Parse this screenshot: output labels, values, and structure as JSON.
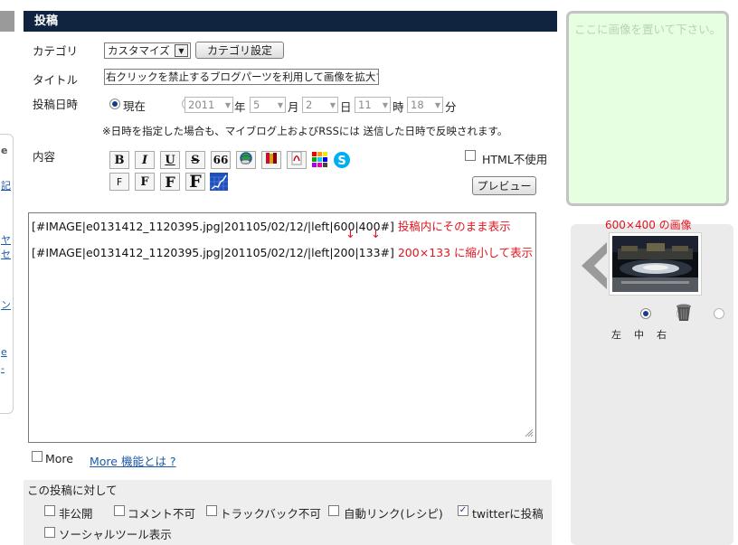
{
  "header": {
    "title": "投稿"
  },
  "left_sidebar": {
    "fragments": [
      "e",
      "記",
      "ヤ",
      "セ",
      "ン",
      "e",
      "-"
    ]
  },
  "form": {
    "category_label": "カテゴリ",
    "category_value": "カスタマイズ",
    "category_button": "カテゴリ設定",
    "title_label": "タイトル",
    "title_value": "右クリックを禁止するブログパーツを利用して画像を拡大する",
    "datetime_label": "投稿日時",
    "now_label": "現在",
    "year_value": "2011",
    "year_suffix": "年",
    "month_value": "5",
    "month_suffix": "月",
    "day_value": "2",
    "day_suffix": "日",
    "hour_value": "11",
    "hour_suffix": "時",
    "minute_value": "18",
    "minute_suffix": "分",
    "note": "※日時を指定した場合も、マイブログ上およびRSSには 送信した日時で反映されます。",
    "content_label": "内容",
    "html_disable_label": "HTML不使用",
    "preview_button": "プレビュー"
  },
  "toolbar": {
    "bold": "B",
    "italic": "I",
    "underline": "U",
    "strike": "S",
    "quote": "66",
    "font_sizes": [
      "F",
      "F",
      "F",
      "F"
    ]
  },
  "editor": {
    "line1": "[#IMAGE|e0131412_1120395.jpg|201105/02/12/|left|600|400#]",
    "note1": "投稿内にそのまま表示",
    "arrows": [
      "↓",
      "↓"
    ],
    "line2": "[#IMAGE|e0131412_1120395.jpg|201105/02/12/|left|200|133#]",
    "note2": "200×133 に縮小して表示"
  },
  "more": {
    "label": "More",
    "link": "More 機能とは ?"
  },
  "post_options": {
    "heading": "この投稿に対して",
    "private": "非公開",
    "no_comment": "コメント不可",
    "no_trackback": "トラックバック不可",
    "auto_link": "自動リンク(レシピ)",
    "twitter": "twitterに投稿",
    "social": "ソーシャルツール表示"
  },
  "drop_zone": {
    "placeholder": "ここに画像を置いて下さい。"
  },
  "image_panel": {
    "caption": "600×400 の画像",
    "align_left": "左",
    "align_center": "中",
    "align_right": "右"
  },
  "colors": {
    "header_bg": "#10233f",
    "annotation_red": "#e0141e",
    "link_blue": "#1a5aa8",
    "drop_bg": "#e5ffe0"
  }
}
